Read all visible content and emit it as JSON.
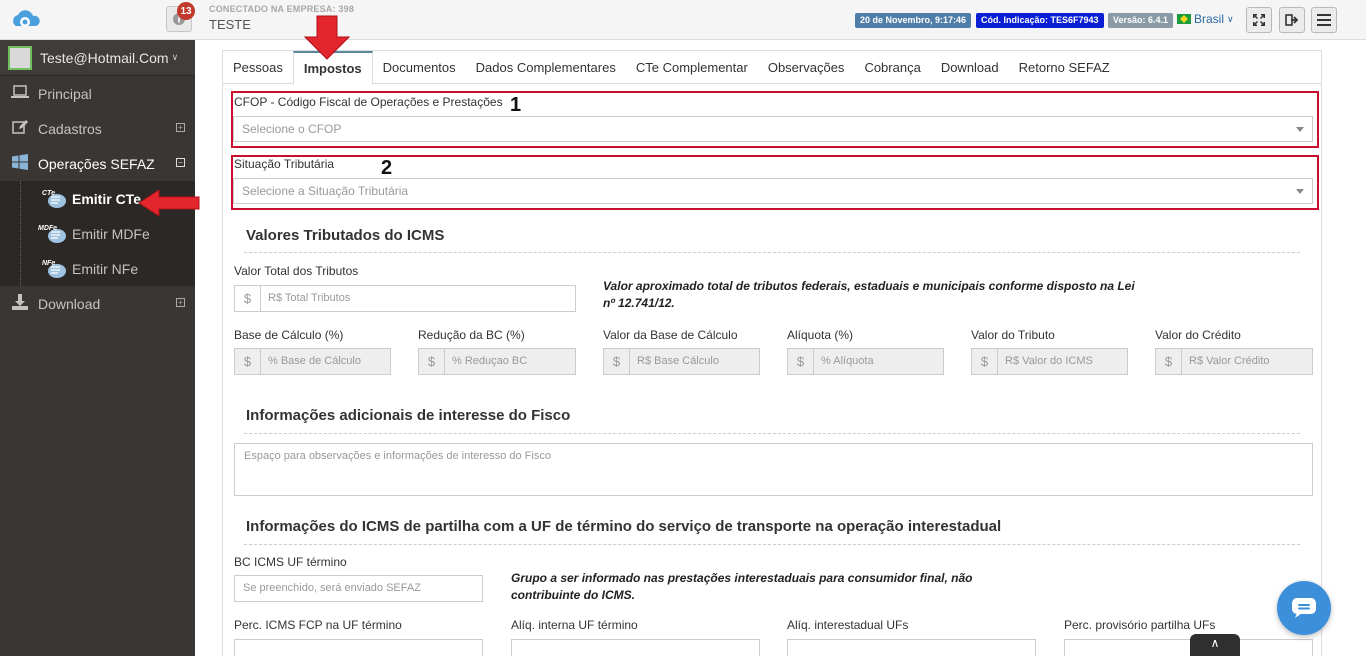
{
  "header": {
    "notifications_count": "13",
    "company_label": "CONECTADO NA EMPRESA: 398",
    "company_name": "TESTE",
    "date_badge": "20 de Novembro, 9:17:46",
    "code_badge": "Cód. Indicação: TES6F7943",
    "version_badge": "Versão: 6.4.1",
    "language": "Brasil",
    "colors": {
      "date": "#4f7fa8",
      "code": "#0b1fd4",
      "version": "#8a9ba6"
    }
  },
  "sidebar": {
    "user": "Teste@Hotmail.Com",
    "items": [
      {
        "label": "Principal",
        "icon": "laptop-icon"
      },
      {
        "label": "Cadastros",
        "icon": "edit-icon"
      },
      {
        "label": "Operações SEFAZ",
        "icon": "windows-icon"
      },
      {
        "label": "Download",
        "icon": "download-icon"
      }
    ],
    "sub_items": [
      {
        "label": "Emitir CTe",
        "tag": "CTe"
      },
      {
        "label": "Emitir MDFe",
        "tag": "MDFe"
      },
      {
        "label": "Emitir NFe",
        "tag": "NFe"
      }
    ]
  },
  "tabs": [
    "Pessoas",
    "Impostos",
    "Documentos",
    "Dados Complementares",
    "CTe Complementar",
    "Observações",
    "Cobrança",
    "Download",
    "Retorno SEFAZ"
  ],
  "form": {
    "cfop_label": "CFOP - Código Fiscal de Operações e Prestações",
    "cfop_placeholder": "Selecione o CFOP",
    "situacao_label": "Situação Tributária",
    "situacao_placeholder": "Selecione a Situação Tributária",
    "annotation_1": "1",
    "annotation_2": "2",
    "icms_title": "Valores Tributados do ICMS",
    "total_tributos_label": "Valor Total dos Tributos",
    "total_tributos_placeholder": "R$ Total Tributos",
    "total_note": "Valor aproximado total de tributos federais, estaduais e municipais conforme disposto na Lei nº 12.741/12.",
    "fields": [
      {
        "label": "Base de Cálculo (%)",
        "placeholder": "% Base de Cálculo"
      },
      {
        "label": "Redução da BC (%)",
        "placeholder": "% Reduçao BC"
      },
      {
        "label": "Valor da Base de Cálculo",
        "placeholder": "R$ Base Cálculo"
      },
      {
        "label": "Alíquota (%)",
        "placeholder": "% Alíquota"
      },
      {
        "label": "Valor do Tributo",
        "placeholder": "R$ Valor do ICMS"
      },
      {
        "label": "Valor do Crédito",
        "placeholder": "R$ Valor Crédito"
      }
    ],
    "fisco_title": "Informações adicionais de interesse do Fisco",
    "fisco_placeholder": "Espaço para observações e informações de interesso do Fisco",
    "partilha_title": "Informações do ICMS de partilha com a UF de término do serviço de transporte na operação interestadual",
    "bc_icms_label": "BC ICMS UF término",
    "bc_icms_placeholder": "Se preenchido, será enviado SEFAZ",
    "partilha_note": "Grupo a ser informado nas prestações interestaduais para consumidor final, não contribuinte do ICMS.",
    "bottom_fields": [
      {
        "label": "Perc. ICMS FCP na UF término"
      },
      {
        "label": "Alíq. interna UF término"
      },
      {
        "label": "Alíq. interestadual UFs"
      },
      {
        "label": "Perc. provisório partilha UFs"
      }
    ]
  }
}
